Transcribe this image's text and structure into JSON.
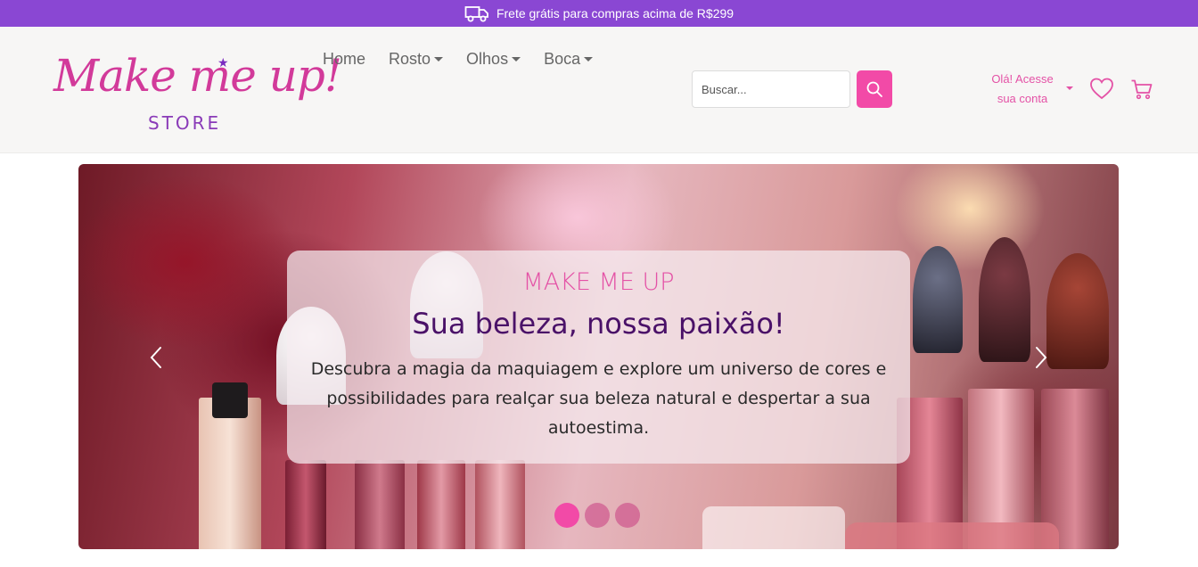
{
  "topbar": {
    "text": "Frete grátis para compras acima de R$299",
    "icon": "truck-icon",
    "color": "#8a47d3"
  },
  "logo": {
    "script": "Make me up!",
    "store": "STORE"
  },
  "nav": {
    "items": [
      {
        "label": "Home",
        "dropdown": false
      },
      {
        "label": "Rosto",
        "dropdown": true
      },
      {
        "label": "Olhos",
        "dropdown": true
      },
      {
        "label": "Boca",
        "dropdown": true
      }
    ]
  },
  "search": {
    "placeholder": "Buscar...",
    "value": "",
    "button_icon": "search-icon",
    "accent": "#f24aa7"
  },
  "account": {
    "line1": "Olá! Acesse",
    "line2": "sua conta"
  },
  "icons": {
    "wishlist": "heart-icon",
    "cart": "cart-icon"
  },
  "hero": {
    "kicker": "MAKE ME UP",
    "headline": "Sua beleza, nossa paixão!",
    "description": "Descubra a magia da maquiagem e explore um universo de cores e possibilidades para realçar sua beleza natural e despertar a sua autoestima.",
    "slides_total": 3,
    "active_slide": 1,
    "prev_icon": "chevron-left-icon",
    "next_icon": "chevron-right-icon"
  }
}
